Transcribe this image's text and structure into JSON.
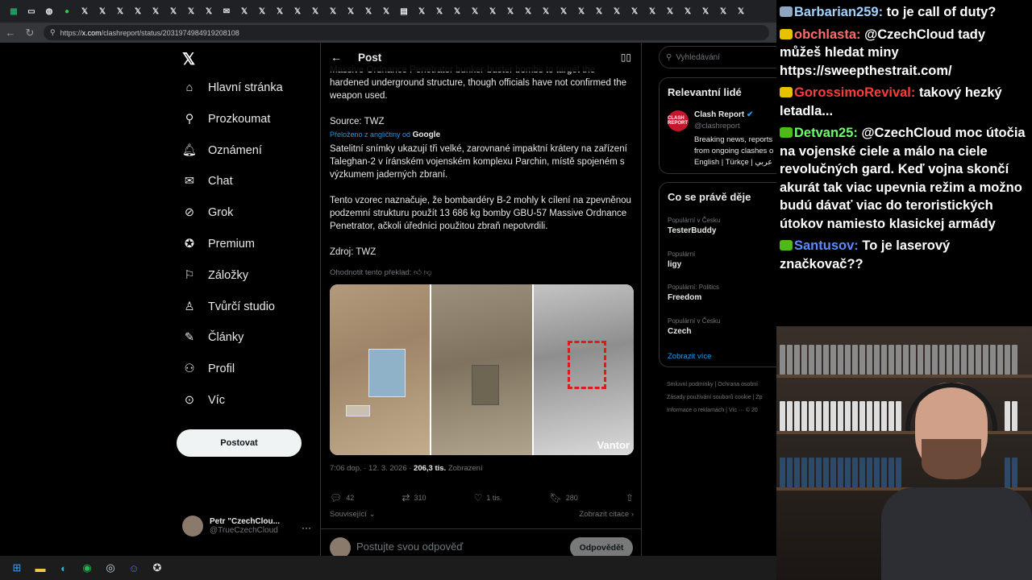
{
  "browser": {
    "tab_icons": [
      "spreadsheet-icon",
      "monitor-icon",
      "globe-icon",
      "n-icon",
      "x-icon",
      "x-icon",
      "x-icon",
      "x-icon",
      "x-icon",
      "x-icon",
      "x-icon",
      "x-icon",
      "mail-icon",
      "x-icon",
      "x-icon",
      "x-icon",
      "x-icon",
      "x-icon",
      "x-icon",
      "x-icon",
      "x-icon",
      "x-icon",
      "calendar-icon",
      "x-icon",
      "x-icon",
      "x-icon",
      "x-icon",
      "x-icon",
      "x-icon",
      "x-icon",
      "x-icon",
      "x-icon",
      "x-icon",
      "x-icon",
      "x-icon",
      "x-icon",
      "x-icon",
      "x-icon",
      "x-icon",
      "x-icon",
      "x-icon",
      "x-icon"
    ],
    "url_prefix": "https://",
    "url_domain": "x.com",
    "url_path": "/clashreport/status/2031974984919208108"
  },
  "left_nav": {
    "items": [
      {
        "label": "Hlavní stránka",
        "icon": "home-icon"
      },
      {
        "label": "Prozkoumat",
        "icon": "search-icon"
      },
      {
        "label": "Oznámení",
        "icon": "bell-icon"
      },
      {
        "label": "Chat",
        "icon": "mail-icon"
      },
      {
        "label": "Grok",
        "icon": "grok-icon"
      },
      {
        "label": "Premium",
        "icon": "verified-icon"
      },
      {
        "label": "Záložky",
        "icon": "bookmark-icon"
      },
      {
        "label": "Tvůrčí studio",
        "icon": "studio-icon"
      },
      {
        "label": "Články",
        "icon": "article-icon"
      },
      {
        "label": "Profil",
        "icon": "person-icon"
      },
      {
        "label": "Víc",
        "icon": "more-icon"
      }
    ],
    "post_button": "Postovat",
    "account_name": "Petr \"CzechClou...",
    "account_handle": "@TrueCzechCloud"
  },
  "post": {
    "header_title": "Post",
    "text_top": "Massive Ordnance Penetrator bunker-buster bombs to target the hardened underground structure, though officials have not confirmed the weapon used.",
    "source": "Source: TWZ",
    "translated_label": "Přeloženo z angličtiny od",
    "translated_brand": "Google",
    "translated_p1": "Satelitní snímky ukazují tři velké, zarovnané impaktní krátery na zařízení Taleghan-2 v íránském vojenském komplexu Parchin, místě spojeném s výzkumem jaderných zbraní.",
    "translated_p2": "Tento vzorec naznačuje, že bombardéry B-2 mohly k cílení na zpevněnou podzemní strukturu použít 13 686 kg bomby GBU-57 Massive Ordnance Penetrator, ačkoli úředníci použitou zbraň nepotvrdili.",
    "translated_source": "Zdroj: TWZ",
    "rate_label": "Ohodnotit tento překlad:",
    "image_watermark": "Vantor",
    "timestamp": "7:06 dop. · 12. 3. 2026 · ",
    "views_value": "206,3 tis.",
    "views_label": " Zobrazení",
    "replies": "42",
    "reposts": "310",
    "likes": "1 tis.",
    "bookmarks": "280",
    "related_label": "Související",
    "quotes_label": "Zobrazit citace",
    "reply_placeholder": "Postujte svou odpověď",
    "reply_button": "Odpovědět"
  },
  "right_col": {
    "search_placeholder": "Vyhledávání",
    "relevant_title": "Relevantní lidé",
    "person_name": "Clash Report",
    "person_handle": "@clashreport",
    "person_avatar_text": "CLASH REPORT",
    "person_bio_1": "Breaking news, reports",
    "person_bio_2": "from ongoing clashes o",
    "person_bio_3": "English | Türkçe | عربي",
    "trends_title": "Co se právě děje",
    "trends": [
      {
        "category": "Populární v Česku",
        "name": "TesterBuddy"
      },
      {
        "category": "Populární",
        "name": "ligy"
      },
      {
        "category": "Populární: Politics",
        "name": "Freedom"
      },
      {
        "category": "Populární v Česku",
        "name": "Czech"
      }
    ],
    "show_more": "Zobrazit více",
    "footer_1": "Smluvní podmínky  |  Ochrana osobní",
    "footer_2": "Zásady používání souborů cookie  |  Zp",
    "footer_3": "Informace o reklamách  |  Víc ···  © 20"
  },
  "taskbar": {
    "icons": [
      "windows-icon",
      "folder-icon",
      "edge-icon",
      "spotify-icon",
      "steam-icon",
      "discord-icon",
      "app-icon"
    ]
  },
  "chat": {
    "messages": [
      {
        "user": "Barbarian259",
        "color": "#9fd3ff",
        "badge": "#8fa6c0",
        "text": "to je call of duty?"
      },
      {
        "user": "obchlasta",
        "color": "#ff6b6b",
        "badge": "#e6c200",
        "text": "@CzechCloud tady můžeš hledat miny https://sweepthestrait.com/"
      },
      {
        "user": "GorossimoRevival",
        "color": "#ff3b3b",
        "badge": "#e6c200",
        "text": "takový hezký letadla..."
      },
      {
        "user": "Detvan25",
        "color": "#6bff6b",
        "badge": "#4cbb17",
        "text": "@CzechCloud moc útočia na vojenské ciele a málo na ciele revolučných gard. Keď vojna skončí akurát tak viac upevnia režim a možno budú dávať viac do teroristických útokov namiesto klasickej armády"
      },
      {
        "user": "Santusov",
        "color": "#5b8cff",
        "badge": "#4cbb17",
        "text": "To je laserový značkovač??"
      }
    ]
  }
}
